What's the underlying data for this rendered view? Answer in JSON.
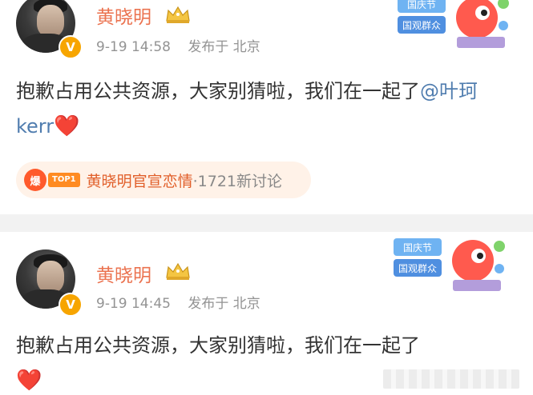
{
  "posts": [
    {
      "username": "黄晓明",
      "date": "9-19 14:58",
      "location": "发布于 北京",
      "content_text": "抱歉占用公共资源，大家别猜啦，我们在一起了",
      "mention": "@叶珂 kerr",
      "heart": "❤️",
      "topic": {
        "badge_icon": "爆",
        "rank_label": "TOP1",
        "title": "黄晓明官宣恋情",
        "count": "·1721新讨论"
      },
      "promo": {
        "line1": "国庆节",
        "line2": "国观群众"
      }
    },
    {
      "username": "黄晓明",
      "date": "9-19 14:45",
      "location": "发布于 北京",
      "content_text": "抱歉占用公共资源，大家别猜啦，我们在一起了",
      "heart": "❤️",
      "promo": {
        "line1": "国庆节",
        "line2": "国观群众"
      }
    }
  ],
  "colors": {
    "username": "#eb7350",
    "mention": "#507daf",
    "meta": "#939393",
    "topic_bg": "#fff2e8"
  },
  "icons": {
    "verified": "v-badge-icon",
    "crown": "crown-icon",
    "heart": "heart-icon"
  }
}
